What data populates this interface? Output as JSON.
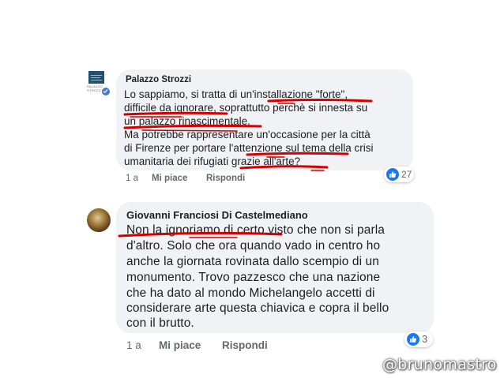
{
  "comment_1": {
    "author": "Palazzo Strozzi",
    "avatar_text": "PALAZZO STROZZI",
    "verified_icon": "verified-check-icon",
    "lines": [
      "Lo sappiamo, si tratta di un'installazione \"forte\",",
      "difficile da ignorare, soprattutto perchè si innesta su",
      "un palazzo rinascimentale.",
      "Ma potrebbe rappresentare un'occasione per la città",
      "di Firenze per portare l'attenzione sul tema della crisi",
      "umanitaria dei rifugiati grazie all'arte?"
    ],
    "time": "1 a",
    "like_label": "Mi piace",
    "reply_label": "Rispondi",
    "reaction_icon": "like-icon",
    "reaction_count": "27"
  },
  "comment_2": {
    "author": "Giovanni Franciosi Di Castelmediano",
    "lines": [
      "Non la ignoriamo di certo visto che non si parla",
      "d'altro. Solo che ora quando vado in centro ho",
      "anche la giornata rovinata dallo scempio di un",
      "monumento. Trovo pazzesco che una nazione",
      "che ha dato al mondo Michelangelo accetti di",
      "considerare arte questa chiavica e copra il bello",
      "con il brutto."
    ],
    "time": "1 a",
    "like_label": "Mi piace",
    "reply_label": "Rispondi",
    "reaction_icon": "like-icon",
    "reaction_count": "3"
  },
  "watermark": "@brunomastro",
  "colors": {
    "bubble": "#f0f2f5",
    "text": "#1c1e21",
    "meta": "#65676b",
    "like_blue": "#1877f2",
    "annotation_red": "#d40000"
  }
}
